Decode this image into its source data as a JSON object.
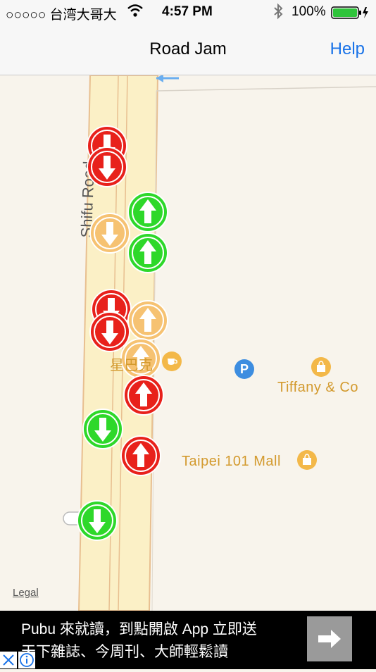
{
  "status_bar": {
    "carrier": "○○○○○ 台湾大哥大",
    "time": "4:57 PM",
    "battery": "100%"
  },
  "nav": {
    "title": "Road Jam",
    "help": "Help"
  },
  "map": {
    "road_label": "Shifu Road",
    "pois": {
      "tiffany": "Tiffany & Co",
      "mall": "Taipei 101 Mall",
      "cafe": "星巴克"
    },
    "legal": "Legal",
    "markers": [
      {
        "direction": "down",
        "color": "#e8211b"
      },
      {
        "direction": "down",
        "color": "#e8211b"
      },
      {
        "direction": "up",
        "color": "#2ed82a"
      },
      {
        "direction": "down",
        "color": "#f6c272"
      },
      {
        "direction": "up",
        "color": "#2ed82a"
      },
      {
        "direction": "down",
        "color": "#e8211b"
      },
      {
        "direction": "up",
        "color": "#f6c272"
      },
      {
        "direction": "down",
        "color": "#e8211b"
      },
      {
        "direction": "up",
        "color": "#f6c272"
      },
      {
        "direction": "up",
        "color": "#e8211b"
      },
      {
        "direction": "down",
        "color": "#2ed82a"
      },
      {
        "direction": "up",
        "color": "#e8211b"
      },
      {
        "direction": "down",
        "color": "#2ed82a"
      }
    ]
  },
  "ad": {
    "line1": "Pubu 來就讀，到點開啟 App 立即送",
    "line2": "天下雜誌、今周刊、大師輕鬆讀"
  }
}
